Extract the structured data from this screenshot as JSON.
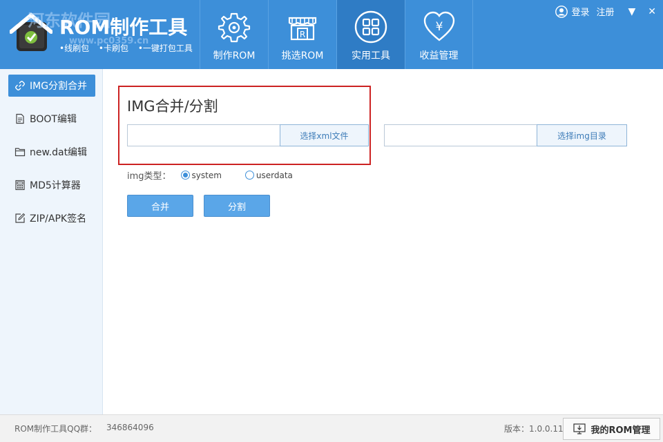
{
  "header": {
    "app_title": "ROM制作工具",
    "subtitle": [
      "•线刷包",
      "•卡刷包",
      "•一键打包工具"
    ],
    "watermark_text": "河东软件园",
    "watermark_url": "www.pc0359.cn",
    "nav": [
      {
        "label": "制作ROM",
        "icon": "gear-icon"
      },
      {
        "label": "挑选ROM",
        "icon": "shop-icon"
      },
      {
        "label": "实用工具",
        "icon": "grid-icon"
      },
      {
        "label": "收益管理",
        "icon": "heart-yen-icon"
      }
    ],
    "active_nav": 2,
    "login": "登录",
    "register": "注册",
    "dropdown_symbol": "▼",
    "close_symbol": "✕"
  },
  "sidebar": {
    "items": [
      {
        "label": "IMG分割合并",
        "icon": "link-icon"
      },
      {
        "label": "BOOT编辑",
        "icon": "document-icon"
      },
      {
        "label": "new.dat编辑",
        "icon": "folder-icon"
      },
      {
        "label": "MD5计算器",
        "icon": "calculator-icon"
      },
      {
        "label": "ZIP/APK签名",
        "icon": "edit-icon"
      }
    ],
    "active": 0
  },
  "main": {
    "title": "IMG合并/分割",
    "xml_input": {
      "value": "",
      "placeholder": ""
    },
    "xml_button": "选择xml文件",
    "img_input": {
      "value": "",
      "placeholder": ""
    },
    "img_button": "选择img目录",
    "img_type_label": "img类型：",
    "radio_options": [
      "system",
      "userdata"
    ],
    "radio_selected": "system",
    "merge_button": "合并",
    "split_button": "分割"
  },
  "footer": {
    "qq_label": "ROM制作工具QQ群：",
    "qq_value": "346864096",
    "version": "版本：1.0.0.11",
    "my_rom_button": "我的ROM管理"
  },
  "colors": {
    "brand_blue": "#3d8fd9",
    "nav_active": "#2f7cc5",
    "highlight_red": "#cc2222"
  }
}
